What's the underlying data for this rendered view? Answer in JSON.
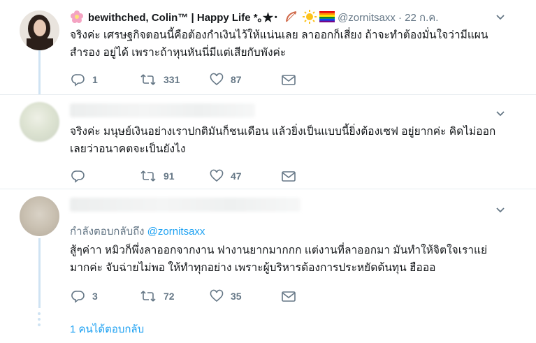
{
  "tweet1": {
    "display_name": "bewithched, Colin™ | Happy Life *｡★･",
    "handle": "@zornitsaxx",
    "date": "· 22 ก.ค.",
    "text": "จริงค่ะ เศรษฐกิจตอนนี้คือต้องกำเงินไว้ให้แน่นเลย ลาออกก็เสี่ยง ถ้าจะทำต้องมั่นใจว่ามีแผนสำรอง อยู่ได้ เพราะถ้าหุนหันนี่มีแต่เสียกับพังค่ะ",
    "replies": "1",
    "retweets": "331",
    "likes": "87"
  },
  "tweet2": {
    "text": "จริงค่ะ มนุษย์เงินอย่างเราปกติมันก็ชนเดือน แล้วยิ่งเป็นแบบนี้ยิ่งต้องเซฟ อยู่ยากค่ะ คิดไม่ออกเลยว่าอนาคตจะเป็นยังไง",
    "replies": "",
    "retweets": "91",
    "likes": "47"
  },
  "tweet3": {
    "reply_prefix": "กำลังตอบกลับถึง ",
    "reply_handle": "@zornitsaxx",
    "text": "สู้ๆค่าา หมิวก็พึ่งลาออกจากงาน ฟางานยากมากกก แต่งานที่ลาออกมา มันทำให้จิตใจเราแย่มากค่ะ จับฉ่ายไม่พอ ให้ทำทุกอย่าง เพราะผู้บริหารต้องการประหยัดต้นทุน ฮือออ",
    "replies": "3",
    "retweets": "72",
    "likes": "35"
  },
  "more_replies_label": "1 คนได้ตอบกลับ",
  "colors": {
    "accent": "#1da1f2",
    "muted": "#657786",
    "thread": "#cfe3f3"
  }
}
